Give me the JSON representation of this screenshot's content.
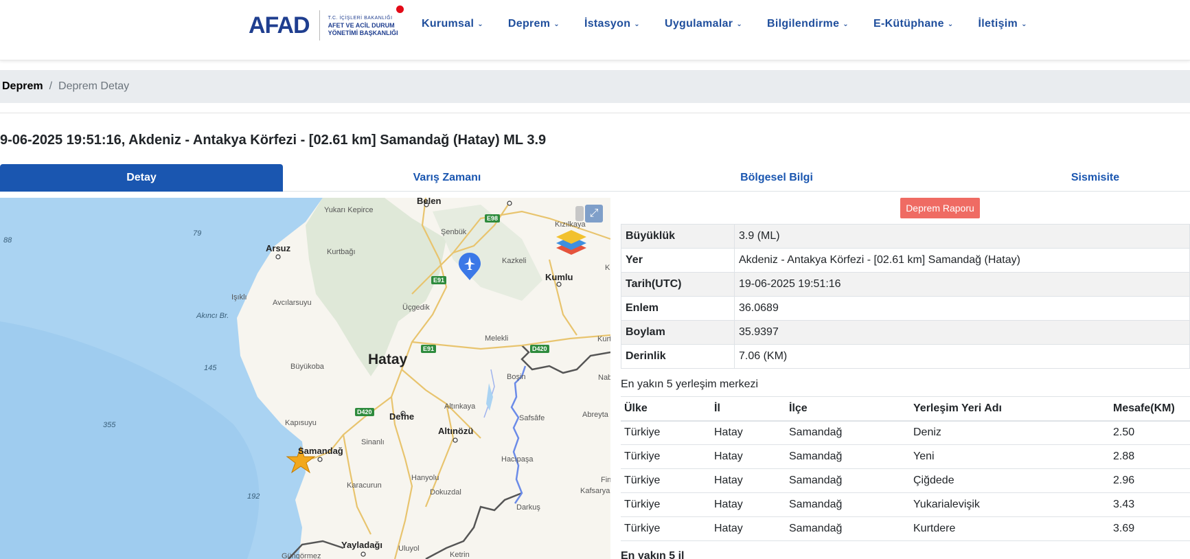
{
  "brand": {
    "logo_text": "AFAD",
    "line1": "T.C. İÇİŞLERİ BAKANLIĞI",
    "line2": "AFET VE ACİL DURUM",
    "line3": "YÖNETİMİ BAŞKANLIĞI"
  },
  "nav": [
    "Kurumsal",
    "Deprem",
    "İstasyon",
    "Uygulamalar",
    "Bilgilendirme",
    "E-Kütüphane",
    "İletişim"
  ],
  "breadcrumb": {
    "root": "Deprem",
    "separator": "/",
    "current": "Deprem Detay"
  },
  "title": "9-06-2025 19:51:16, Akdeniz - Antakya Körfezi - [02.61 km] Samandağ (Hatay) ML 3.9",
  "tabs": [
    "Detay",
    "Varış Zamanı",
    "Bölgesel Bilgi",
    "Sismisite"
  ],
  "report_button": "Deprem Raporu",
  "details": [
    {
      "key": "Büyüklük",
      "value": "3.9 (ML)"
    },
    {
      "key": "Yer",
      "value": "Akdeniz - Antakya Körfezi - [02.61 km] Samandağ (Hatay)"
    },
    {
      "key": "Tarih(UTC)",
      "value": "19-06-2025 19:51:16"
    },
    {
      "key": "Enlem",
      "value": "36.0689"
    },
    {
      "key": "Boylam",
      "value": "35.9397"
    },
    {
      "key": "Derinlik",
      "value": "7.06 (KM)"
    }
  ],
  "nearest_label": "En yakın 5 yerleşim merkezi",
  "nearest_headers": [
    "Ülke",
    "İl",
    "İlçe",
    "Yerleşim Yeri Adı",
    "Mesafe(KM)"
  ],
  "nearest_rows": [
    [
      "Türkiye",
      "Hatay",
      "Samandağ",
      "Deniz",
      "2.50"
    ],
    [
      "Türkiye",
      "Hatay",
      "Samandağ",
      "Yeni",
      "2.88"
    ],
    [
      "Türkiye",
      "Hatay",
      "Samandağ",
      "Çiğdede",
      "2.96"
    ],
    [
      "Türkiye",
      "Hatay",
      "Samandağ",
      "Yukarialevişik",
      "3.43"
    ],
    [
      "Türkiye",
      "Hatay",
      "Samandağ",
      "Kurtdere",
      "3.69"
    ]
  ],
  "next_section_label": "En yakın 5 il",
  "map": {
    "labels": {
      "hatay": "Hatay",
      "belen": "Belen",
      "arsuz": "Arsuz",
      "kumlu": "Kumlu",
      "defne": "Defne",
      "altinozu": "Altınözü",
      "samandag": "Samandağ",
      "yayladagi": "Yayladağı",
      "yukari_kepirce": "Yukarı Kepirce",
      "senbuk": "Şenbük",
      "kurtbagi": "Kurtbağı",
      "kazkeli": "Kazkeli",
      "kizilkaya": "Kızılkaya",
      "isikli": "Işıklı",
      "avcilarsuyu": "Avcılarsuyu",
      "ucgedik": "Üçgedik",
      "melekli": "Melekli",
      "buyukoba": "Büyükoba",
      "bosin": "Boşin",
      "altinkaya": "Altınkaya",
      "safsafe": "Safsâfe",
      "abreyta": "Abreyta",
      "kapisuyu": "Kapısuyu",
      "sinanli": "Sinanlı",
      "hacipasa": "Hacıpaşa",
      "hanyolu": "Hanyolu",
      "dokuzdal": "Dokuzdal",
      "karacurun": "Karacurun",
      "darkus": "Darkuş",
      "kafsarya": "Kafsarya",
      "uluyol": "Uluyol",
      "ketrin": "Ketrin",
      "gungormez": "Güngörmez",
      "akinci": "Akıncı Br.",
      "nab": "Nab",
      "kurt": "Kurt",
      "fin": "Fin",
      "k": "K"
    },
    "depths": [
      "88",
      "79",
      "145",
      "355",
      "192"
    ],
    "roads": [
      "E98",
      "E91",
      "E91",
      "D420",
      "D420"
    ],
    "colors": {
      "sea": "#aad3f2",
      "land": "#f7f5ef",
      "forest": "#dfe8d8",
      "road": "#e8c46e",
      "border": "#555555",
      "river": "#6b8be8",
      "star": "#f2a81d"
    }
  }
}
